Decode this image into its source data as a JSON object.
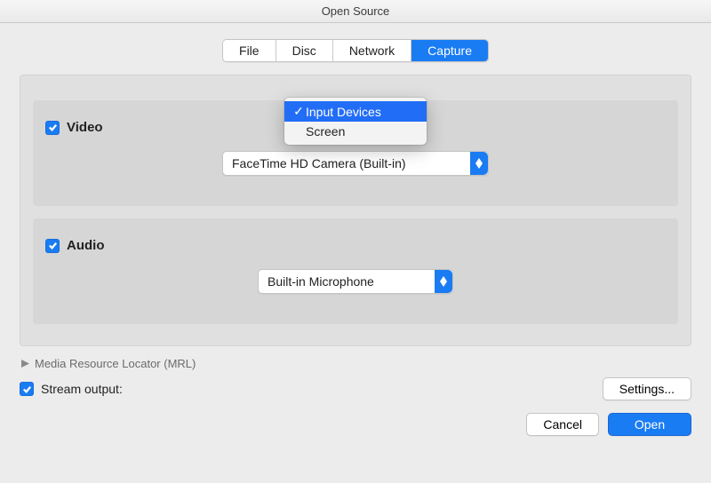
{
  "window": {
    "title": "Open Source"
  },
  "tabs": {
    "file": "File",
    "disc": "Disc",
    "network": "Network",
    "capture": "Capture",
    "active": "capture"
  },
  "capture_menu": {
    "items": [
      {
        "label": "Input Devices",
        "selected": true
      },
      {
        "label": "Screen",
        "selected": false
      }
    ]
  },
  "video": {
    "label": "Video",
    "checked": true,
    "device": "FaceTime HD Camera (Built-in)"
  },
  "audio": {
    "label": "Audio",
    "checked": true,
    "device": "Built-in Microphone"
  },
  "mrl": {
    "label": "Media Resource Locator (MRL)"
  },
  "stream": {
    "checked": true,
    "label": "Stream output:",
    "settings_label": "Settings..."
  },
  "buttons": {
    "cancel": "Cancel",
    "open": "Open"
  }
}
